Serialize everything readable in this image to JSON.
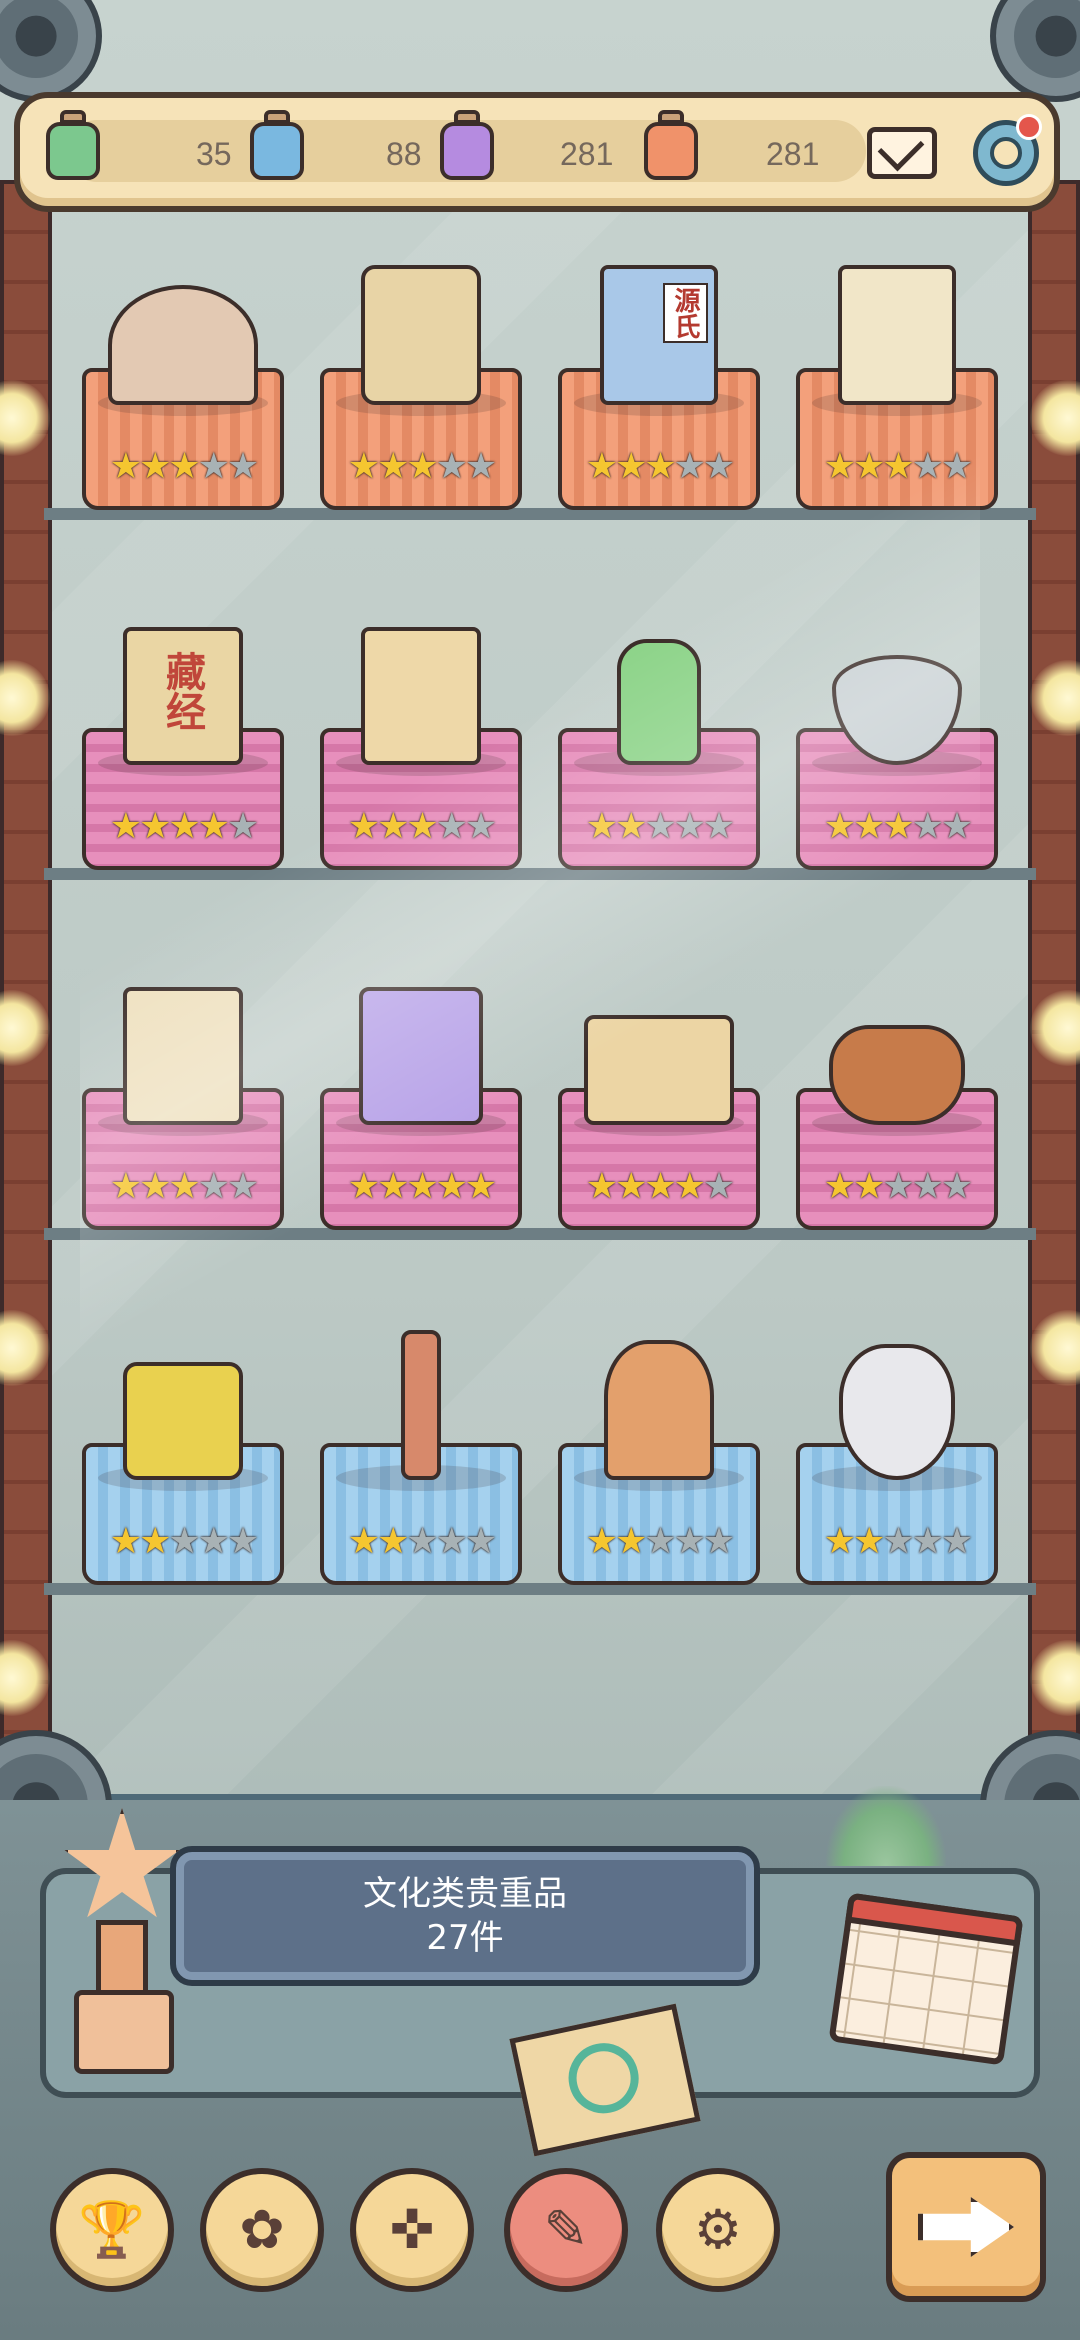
{
  "resources": [
    {
      "name": "green-ink-jar",
      "value": "35",
      "color": "#7cc88e"
    },
    {
      "name": "blue-ink-jar",
      "value": "88",
      "color": "#7ab8e0"
    },
    {
      "name": "purple-ink-jar",
      "value": "281",
      "color": "#b58be0"
    },
    {
      "name": "orange-ink-jar",
      "value": "281",
      "color": "#f0926a"
    }
  ],
  "collection": {
    "category": "文化类贵重品",
    "count": "27件"
  },
  "shelves": [
    {
      "cloth": "orange",
      "items": [
        {
          "name": "pieta-statue",
          "rating": 3
        },
        {
          "name": "stone-tablet",
          "rating": 3
        },
        {
          "name": "genji-book",
          "rating": 3,
          "label": "源氏"
        },
        {
          "name": "painted-scroll-book",
          "rating": 3
        }
      ]
    },
    {
      "cloth": "pink",
      "items": [
        {
          "name": "sutra-book",
          "rating": 4,
          "label": "藏经"
        },
        {
          "name": "shakespeare-book",
          "rating": 3
        },
        {
          "name": "poison-bottle",
          "rating": 2
        },
        {
          "name": "spinning-top",
          "rating": 3
        }
      ]
    },
    {
      "cloth": "pink",
      "items": [
        {
          "name": "herbal-book",
          "rating": 3
        },
        {
          "name": "purple-spell-book",
          "rating": 5
        },
        {
          "name": "open-journal",
          "rating": 4
        },
        {
          "name": "tobacco-pipe",
          "rating": 2
        }
      ]
    },
    {
      "cloth": "blue",
      "items": [
        {
          "name": "rubiks-cube",
          "rating": 2
        },
        {
          "name": "ancient-arrow",
          "rating": 2
        },
        {
          "name": "seated-figure-statue",
          "rating": 2
        },
        {
          "name": "tribal-mask",
          "rating": 2
        }
      ]
    }
  ],
  "nav": [
    {
      "name": "trophy",
      "glyph": "🏆"
    },
    {
      "name": "rose",
      "glyph": "✿"
    },
    {
      "name": "compass",
      "glyph": "✜"
    },
    {
      "name": "quill-scroll",
      "glyph": "✎",
      "active": true
    },
    {
      "name": "gear",
      "glyph": "⚙"
    }
  ],
  "colors": {
    "star_on": "#f5c630",
    "star_off": "#a8b2b5",
    "banner": "#5d7089"
  }
}
